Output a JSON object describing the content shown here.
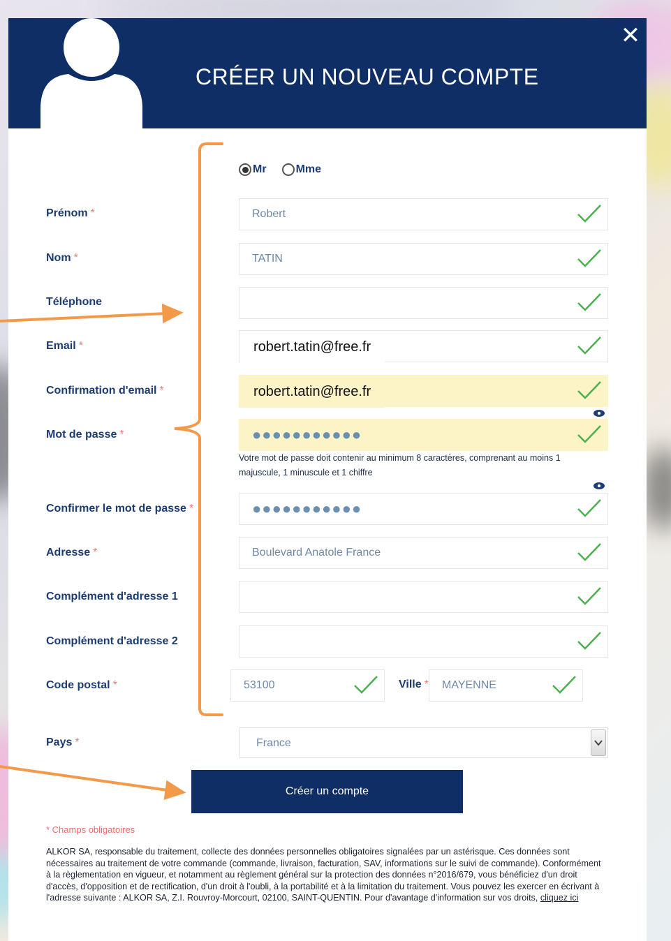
{
  "header": {
    "title": "CRÉER UN NOUVEAU COMPTE",
    "close_label": "✕",
    "background_color": "#0f2e66"
  },
  "civility": {
    "options": [
      {
        "label": "Mr",
        "selected": true
      },
      {
        "label": "Mme",
        "selected": false
      }
    ]
  },
  "form": {
    "required_marker": "*",
    "prenom": {
      "label": "Prénom",
      "value": "Robert"
    },
    "nom": {
      "label": "Nom",
      "value": "TATIN"
    },
    "telephone": {
      "label": "Téléphone",
      "value": ""
    },
    "email": {
      "label": "Email",
      "value": "robert.tatin@free.fr"
    },
    "email_confirm": {
      "label": "Confirmation d'email",
      "value": "robert.tatin@free.fr"
    },
    "password": {
      "label": "Mot de passe",
      "value": "●●●●●●●●●●●"
    },
    "password_hint": "Votre mot de passe doit contenir au minimum 8 caractères, comprenant au moins 1 majuscule, 1 minuscule et 1 chiffre",
    "password_confirm": {
      "label": "Confirmer le mot de passe",
      "value": "●●●●●●●●●●●"
    },
    "adresse": {
      "label": "Adresse",
      "value": "Boulevard Anatole France"
    },
    "complement1": {
      "label": "Complément d'adresse 1",
      "value": ""
    },
    "complement2": {
      "label": "Complément d'adresse 2",
      "value": ""
    },
    "code_postal": {
      "label": "Code postal",
      "value": "53100"
    },
    "ville": {
      "label": "Ville",
      "value": "MAYENNE"
    },
    "pays": {
      "label": "Pays",
      "value": "France"
    }
  },
  "submit_label": "Créer un compte",
  "mandatory_note": "* Champs obligatoires",
  "legal": {
    "text": "ALKOR SA, responsable du traitement, collecte des données personnelles obligatoires signalées par un astérisque. Ces données sont nécessaires au traitement de votre commande (commande, livraison, facturation, SAV, informations sur le suivi de commande). Conformément à la règlementation en vigueur, et notamment au règlement général sur la protection des données n°2016/679, vous bénéficiez d'un droit d'accès, d'opposition et de rectification, d'un droit à l'oubli, à la portabilité et à la limitation du traitement. Vous pouvez les exercer en écrivant à l'adresse suivante : ALKOR SA, Z.I. Rouvroy-Morcourt, 02100, SAINT-QUENTIN. Pour d'avantage d'information sur vos droits, ",
    "link": "cliquez ici"
  },
  "colors": {
    "label": "#1d3c72",
    "check": "#4caf50",
    "annotation": "#f29a4a",
    "highlight": "#fcf4c6"
  },
  "icons": [
    "user-avatar-icon",
    "close-icon",
    "checkmark-icon",
    "eye-icon",
    "chevron-down-icon"
  ]
}
